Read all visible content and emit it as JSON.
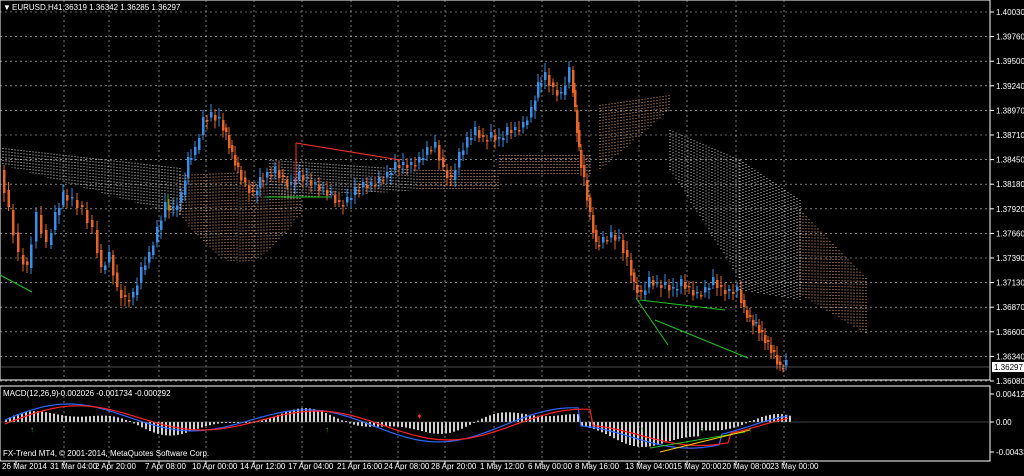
{
  "chart": {
    "symbol_header": "EURUSD,H4",
    "ohlc": "1.36319 1.36342 1.36285 1.36297",
    "current_price": "1.36297",
    "price_ticks": [
      "1.40030",
      "1.39760",
      "1.39500",
      "1.39240",
      "1.38970",
      "1.38710",
      "1.38450",
      "1.38180",
      "1.37920",
      "1.37660",
      "1.37390",
      "1.37130",
      "1.36870",
      "1.36600",
      "1.36340",
      "1.36080"
    ],
    "macd_header": "MACD(12,26,9)",
    "macd_values": "-0.002026 -0.001734 -0.000292",
    "macd_ticks": [
      "0.004123",
      "0.00",
      "-0.004338"
    ],
    "time_ticks": [
      "26 Mar 2014",
      "31 Mar 04:00",
      "2 Apr 20:00",
      "7 Apr 08:00",
      "10 Apr 00:00",
      "14 Apr 12:00",
      "17 Apr 04:00",
      "21 Apr 16:00",
      "24 Apr 08:00",
      "28 Apr 20:00",
      "1 May 12:00",
      "6 May 00:00",
      "8 May 16:00",
      "13 May 04:00",
      "15 May 20:00",
      "20 May 08:00",
      "23 May 00:00"
    ],
    "copyright": "FX-Trend MT4, © 2001-2014, MetaQuotes Software Corp.",
    "colors": {
      "background": "#000000",
      "grid": "#c8c8c8",
      "bull": "#3a8ee6",
      "bear": "#e8652a",
      "cloud_a": "#d9d9d9",
      "cloud_b": "#f0a878",
      "macd_main": "#2a66ff",
      "macd_signal": "#ff2020",
      "histogram": "#d0d0d0",
      "trendline_green": "#22c322",
      "trendline_red": "#ff3030"
    }
  }
}
